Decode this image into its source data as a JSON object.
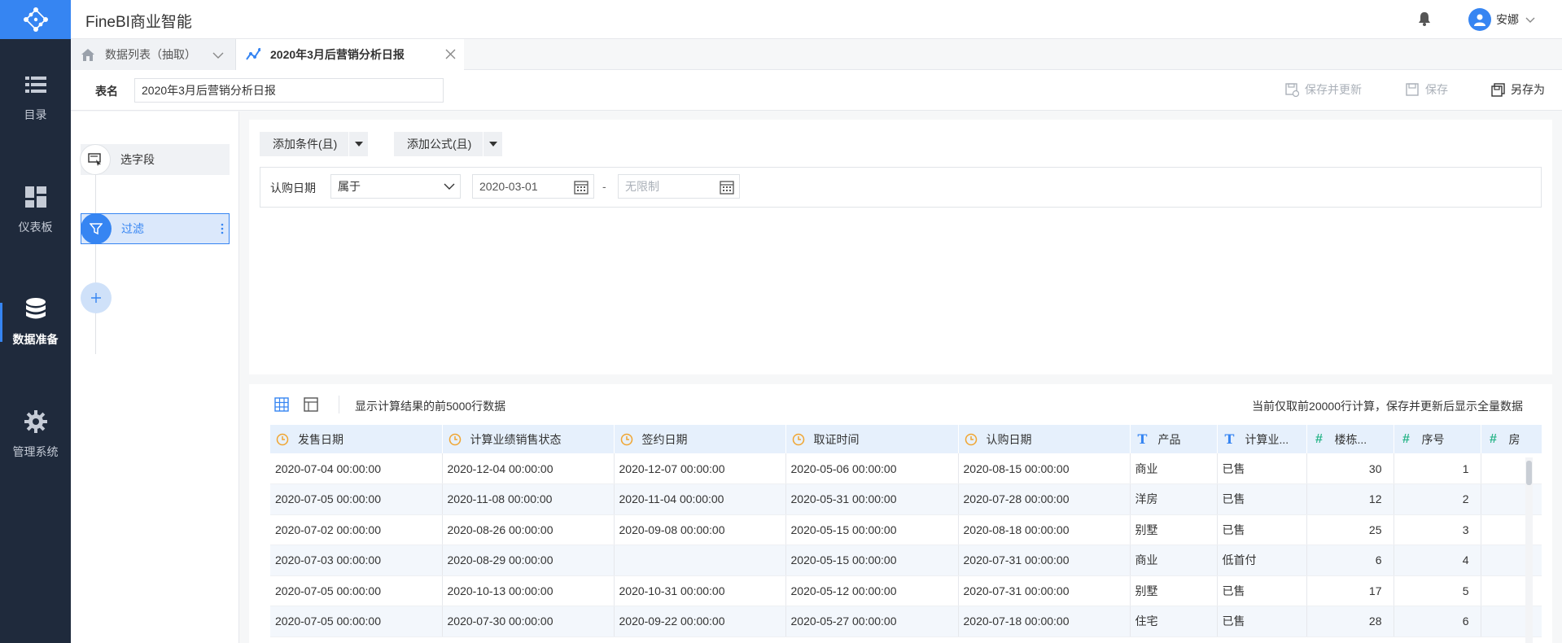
{
  "app": {
    "title": "FineBI商业智能"
  },
  "nav": {
    "items": [
      {
        "label": "目录",
        "icon": "list-icon"
      },
      {
        "label": "仪表板",
        "icon": "dashboard-icon"
      },
      {
        "label": "数据准备",
        "icon": "database-icon",
        "active": true
      },
      {
        "label": "管理系统",
        "icon": "gear-icon"
      }
    ]
  },
  "user": {
    "name": "安娜"
  },
  "tabs": [
    {
      "label": "数据列表（抽取）",
      "icon": "home-icon"
    },
    {
      "label": "2020年3月后营销分析日报",
      "icon": "trend-icon",
      "active": true
    }
  ],
  "namebar": {
    "label": "表名",
    "value": "2020年3月后营销分析日报",
    "save_update": "保存并更新",
    "save": "保存",
    "save_as": "另存为"
  },
  "steps": [
    {
      "label": "选字段",
      "icon": "select-field-icon"
    },
    {
      "label": "过滤",
      "icon": "filter-icon",
      "active": true
    }
  ],
  "filter": {
    "add_condition": "添加条件(且)",
    "add_formula": "添加公式(且)",
    "field": "认购日期",
    "operator": "属于",
    "start": "2020-03-01",
    "separator": "-",
    "end_placeholder": "无限制"
  },
  "preview": {
    "info": "显示计算结果的前5000行数据",
    "note": "当前仅取前20000行计算，保存并更新后显示全量数据",
    "columns": [
      {
        "label": "发售日期",
        "type": "date"
      },
      {
        "label": "计算业绩销售状态",
        "type": "date"
      },
      {
        "label": "签约日期",
        "type": "date"
      },
      {
        "label": "取证时间",
        "type": "date"
      },
      {
        "label": "认购日期",
        "type": "date"
      },
      {
        "label": "产品",
        "type": "text"
      },
      {
        "label": "计算业...",
        "type": "text"
      },
      {
        "label": "楼栋...",
        "type": "num"
      },
      {
        "label": "序号",
        "type": "num"
      },
      {
        "label": "房",
        "type": "num"
      }
    ],
    "rows": [
      [
        "2020-07-04 00:00:00",
        "2020-12-04 00:00:00",
        "2020-12-07 00:00:00",
        "2020-05-06 00:00:00",
        "2020-08-15 00:00:00",
        "商业",
        "已售",
        "30",
        "1",
        ""
      ],
      [
        "2020-07-05 00:00:00",
        "2020-11-08 00:00:00",
        "2020-11-04 00:00:00",
        "2020-05-31 00:00:00",
        "2020-07-28 00:00:00",
        "洋房",
        "已售",
        "12",
        "2",
        ""
      ],
      [
        "2020-07-02 00:00:00",
        "2020-08-26 00:00:00",
        "2020-09-08 00:00:00",
        "2020-05-15 00:00:00",
        "2020-08-18 00:00:00",
        "别墅",
        "已售",
        "25",
        "3",
        ""
      ],
      [
        "2020-07-03 00:00:00",
        "2020-08-29 00:00:00",
        "",
        "2020-05-15 00:00:00",
        "2020-07-31 00:00:00",
        "商业",
        "低首付",
        "6",
        "4",
        ""
      ],
      [
        "2020-07-05 00:00:00",
        "2020-10-13 00:00:00",
        "2020-10-31 00:00:00",
        "2020-05-12 00:00:00",
        "2020-07-31 00:00:00",
        "别墅",
        "已售",
        "17",
        "5",
        ""
      ],
      [
        "2020-07-05 00:00:00",
        "2020-07-30 00:00:00",
        "2020-09-22 00:00:00",
        "2020-05-27 00:00:00",
        "2020-07-18 00:00:00",
        "住宅",
        "已售",
        "28",
        "6",
        ""
      ]
    ]
  },
  "colors": {
    "accent": "#3685f2",
    "sidebar": "#1f2a3c",
    "date_icon": "#f0a531",
    "num_icon": "#2bb58a"
  }
}
